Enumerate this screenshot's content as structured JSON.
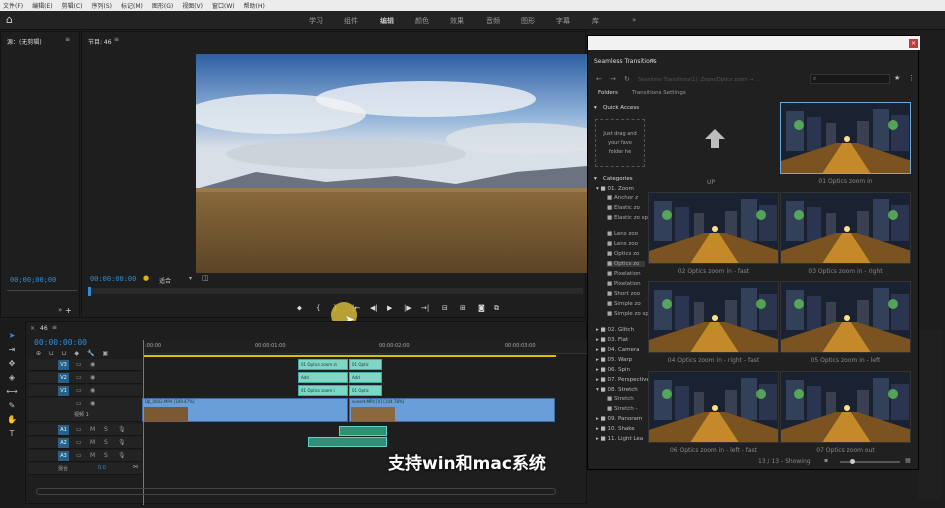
{
  "menu": [
    "文件(F)",
    "编辑(E)",
    "剪辑(C)",
    "序列(S)",
    "标记(M)",
    "图形(G)",
    "视图(V)",
    "窗口(W)",
    "帮助(H)"
  ],
  "workspaces": [
    "学习",
    "组件",
    "编辑",
    "颜色",
    "效果",
    "音频",
    "图形",
    "字幕",
    "库",
    "»"
  ],
  "source_panel": {
    "title": "源：(无剪辑)",
    "timecode": "00;00;00;00"
  },
  "program_panel": {
    "title": "节目: 46",
    "timecode": "00:00:00:00",
    "fit_label": "适合"
  },
  "timeline": {
    "tab": "46",
    "timecode": "00:00:00:00",
    "ruler": [
      ":00:00",
      "00:00:01:00",
      "00:00:02:00",
      "00:00:03:00"
    ],
    "video_tracks": [
      "V3",
      "V2",
      "V1"
    ],
    "audio_tracks": [
      "A1",
      "A2",
      "A3"
    ],
    "v1_label": "视频 1",
    "mix_label": "混合",
    "mix_value": "0.0",
    "clips": {
      "v3_a": "01 Optics zoom in",
      "v3_b": "01 Optic",
      "v2_a": "Add",
      "v2_b": "Add",
      "v1_a": "01 Optics zoom i",
      "v1_b": "01 Optic",
      "main_a": "DJI_0002.MP4 [109.47%]",
      "main_b": "sunset.MP4 [V] [104.78%]"
    }
  },
  "subtitle": "支持win和mac系统",
  "transitions_panel": {
    "title": "Seamless Transitions",
    "path": "Seamless Transitions(1): Zoom/Optics zoom → ...",
    "tabs": [
      "Folders",
      "Transitions Settings"
    ],
    "quick_access_title": "Quick Access",
    "quick_access_text": [
      "Just drag and",
      "your favo",
      "folder he"
    ],
    "categories_title": "Categories",
    "categories": [
      {
        "label": "01. Zoom",
        "sub": [
          "Anchor z",
          "Elastic zo",
          "Elastic zo split",
          "Lens zoo",
          "Lens zoo",
          "Optics zo",
          "Optics zo",
          "Pixelation",
          "Pixelation",
          "Short zoo",
          "Simple zo",
          "Simple zo split"
        ]
      },
      {
        "label": "02. Glitch",
        "sub": []
      },
      {
        "label": "03. Flat",
        "sub": []
      },
      {
        "label": "04. Camera",
        "sub": []
      },
      {
        "label": "05. Warp",
        "sub": []
      },
      {
        "label": "06. Spin",
        "sub": []
      },
      {
        "label": "07. Perspective",
        "sub": []
      },
      {
        "label": "08. Stretch",
        "sub": [
          "Stretch",
          "Stretch -"
        ]
      },
      {
        "label": "09. Panoram",
        "sub": []
      },
      {
        "label": "10. Shake",
        "sub": []
      },
      {
        "label": "11. Light Lea",
        "sub": []
      }
    ],
    "up_label": "UP",
    "items": [
      "01 Optics zoom in",
      "02 Optics zoom in - fast",
      "03 Optics zoom in - right",
      "04 Optics zoom in - right - fast",
      "05 Optics zoom in - left",
      "06 Optics zoom in - left - fast",
      "07 Optics zoom out"
    ],
    "footer": "13 / 13 - Showing"
  },
  "colors": {
    "accent": "#2e8ddb",
    "panel_bg": "#1e1e1e",
    "clip_green": "#7fd6c4",
    "clip_blue": "#6a9ed8"
  }
}
